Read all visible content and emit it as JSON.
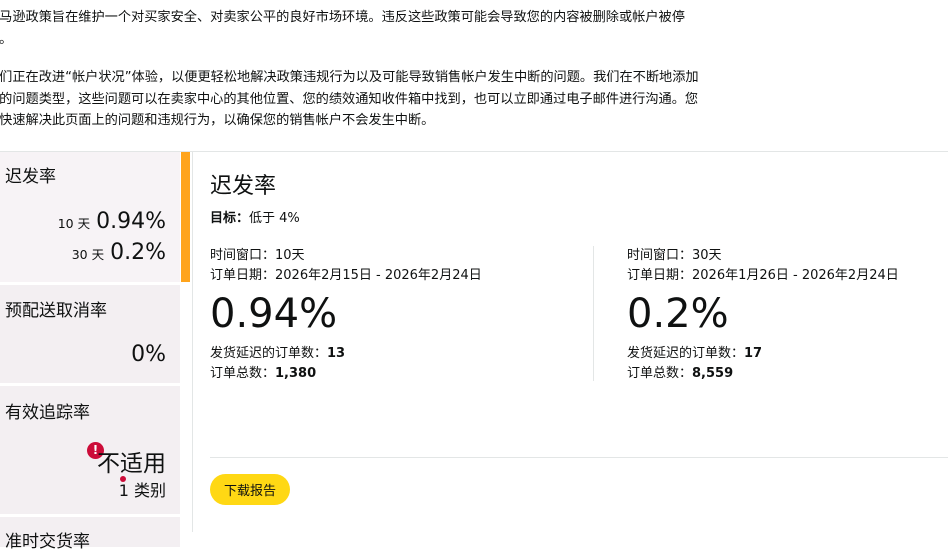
{
  "intro": {
    "paragraph1": "亚马逊政策旨在维护一个对买家安全、对卖家公平的良好市场环境。违反这些政策可能会导致您的内容被删除或帐户被停用。",
    "paragraph2": "我们正在改进“帐户状况”体验，以便更轻松地解决政策违规行为以及可能导致销售帐户发生中断的问题。我们在不断地添加新的问题类型，这些问题可以在卖家中心的其他位置、您的绩效通知收件箱中找到，也可以立即通过电子邮件进行沟通。您应快速解决此页面上的问题和违规行为，以确保您的销售帐户不会发生中断。"
  },
  "sidebar": {
    "late_shipment": {
      "title": "迟发率",
      "rows": [
        {
          "label": "10 天",
          "value": "0.94%"
        },
        {
          "label": "30 天",
          "value": "0.2%"
        }
      ]
    },
    "pre_fulfillment_cancel": {
      "title": "预配送取消率",
      "value": "0%"
    },
    "valid_tracking": {
      "title": "有效追踪率",
      "status_icon": "!",
      "value": "不适用",
      "category": "1 类别"
    },
    "on_time_delivery": {
      "title": "准时交货率"
    }
  },
  "detail": {
    "title": "迟发率",
    "target_label": "目标：",
    "target_value": "低于 4%",
    "columns": [
      {
        "window": "时间窗口：10天",
        "date_range": "订单日期：2026年2月15日 - 2026年2月24日",
        "rate": "0.94%",
        "late_label": "发货延迟的订单数：",
        "late_value": "13",
        "total_label": "订单总数：",
        "total_value": "1,380"
      },
      {
        "window": "时间窗口：30天",
        "date_range": "订单日期：2026年1月26日 - 2026年2月24日",
        "rate": "0.2%",
        "late_label": "发货延迟的订单数：",
        "late_value": "17",
        "total_label": "订单总数：",
        "total_value": "8,559"
      }
    ],
    "download_label": "下载报告"
  },
  "colors": {
    "accent": "#ffa41c",
    "button": "#ffd814",
    "alert": "#cc0c39"
  }
}
